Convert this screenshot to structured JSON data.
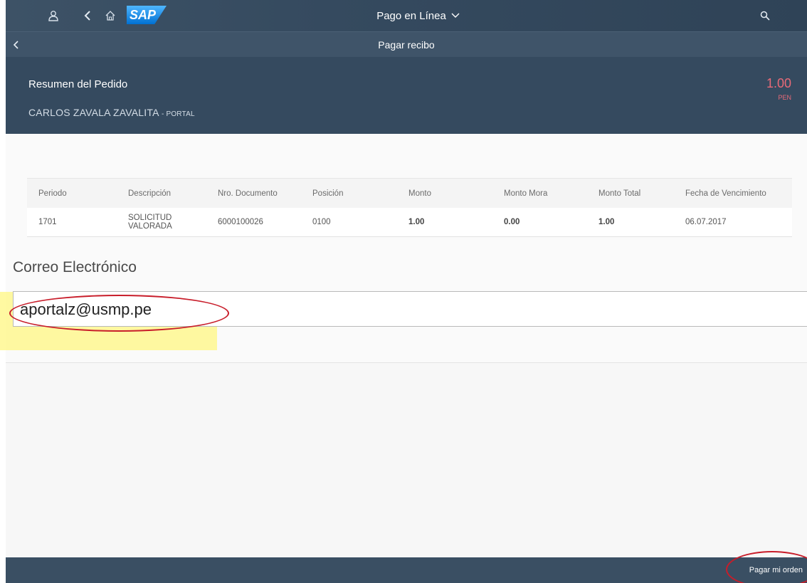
{
  "shellbar": {
    "title": "Pago en Línea",
    "logo": "SAP",
    "icons": [
      "user-icon",
      "back-icon",
      "home-icon",
      "chevron-down-icon",
      "search-icon"
    ]
  },
  "subheader": {
    "title": "Pagar recibo"
  },
  "summary": {
    "title": "Resumen del Pedido",
    "customer_name": "CARLOS ZAVALA ZAVALITA",
    "customer_suffix": "- PORTAL",
    "amount": "1.00",
    "currency": "PEN"
  },
  "table": {
    "headers": [
      "Periodo",
      "Descripción",
      "Nro. Documento",
      "Posición",
      "Monto",
      "Monto Mora",
      "Monto Total",
      "Fecha de Vencimiento"
    ],
    "rows": [
      [
        "1701",
        "SOLICITUD VALORADA",
        "6000100026",
        "0100",
        "1.00",
        "0.00",
        "1.00",
        "06.07.2017"
      ]
    ]
  },
  "email": {
    "label": "Correo Electrónico",
    "value": "aportalz@usmp.pe"
  },
  "footer": {
    "pay_label": "Pagar mi orden"
  },
  "colors": {
    "shell": "#354a5f",
    "amount": "#e96a78",
    "annotation": "#c81d2a",
    "highlight": "#fff782"
  }
}
